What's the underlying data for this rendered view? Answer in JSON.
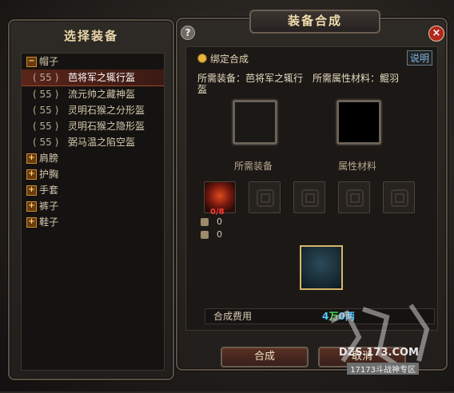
{
  "left": {
    "title": "选择装备",
    "categories": [
      {
        "sign": "−",
        "label": "帽子"
      },
      {
        "sign": "+",
        "label": "肩膀"
      },
      {
        "sign": "+",
        "label": "护胸"
      },
      {
        "sign": "+",
        "label": "手套"
      },
      {
        "sign": "+",
        "label": "裤子"
      },
      {
        "sign": "+",
        "label": "鞋子"
      }
    ],
    "items": [
      {
        "level": "( 55 )",
        "name": "芭将军之辄行盔"
      },
      {
        "level": "( 55 )",
        "name": "流元帅之藏神盔"
      },
      {
        "level": "( 55 )",
        "name": "灵明石猴之分形盔"
      },
      {
        "level": "( 55 )",
        "name": "灵明石猴之隐形盔"
      },
      {
        "level": "( 55 )",
        "name": "弼马温之陷空盔"
      }
    ]
  },
  "right": {
    "title": "装备合成",
    "help_icon": "?",
    "close_icon": "×",
    "bind_label": "绑定合成",
    "explain": "说明",
    "req_equip_label": "所需装备：芭将军之辄行",
    "req_equip_wrap": "盔",
    "req_material_label": "所需属性材料：鲲羽",
    "slot_equip_label": "所需装备",
    "slot_material_label": "属性材料",
    "material_count": "0/8",
    "resource_1": "0",
    "resource_2": "0",
    "cost_label": "合成费用",
    "cost_value_a": "4",
    "cost_value_b": "万",
    "cost_value_c": "0",
    "cost_value_d": "两",
    "craft_button": "合成",
    "cancel_button": "取消"
  },
  "watermark": {
    "site": "DZS.173.COM",
    "sub": "17173斗战神专区",
    "logo": "斗战神"
  }
}
